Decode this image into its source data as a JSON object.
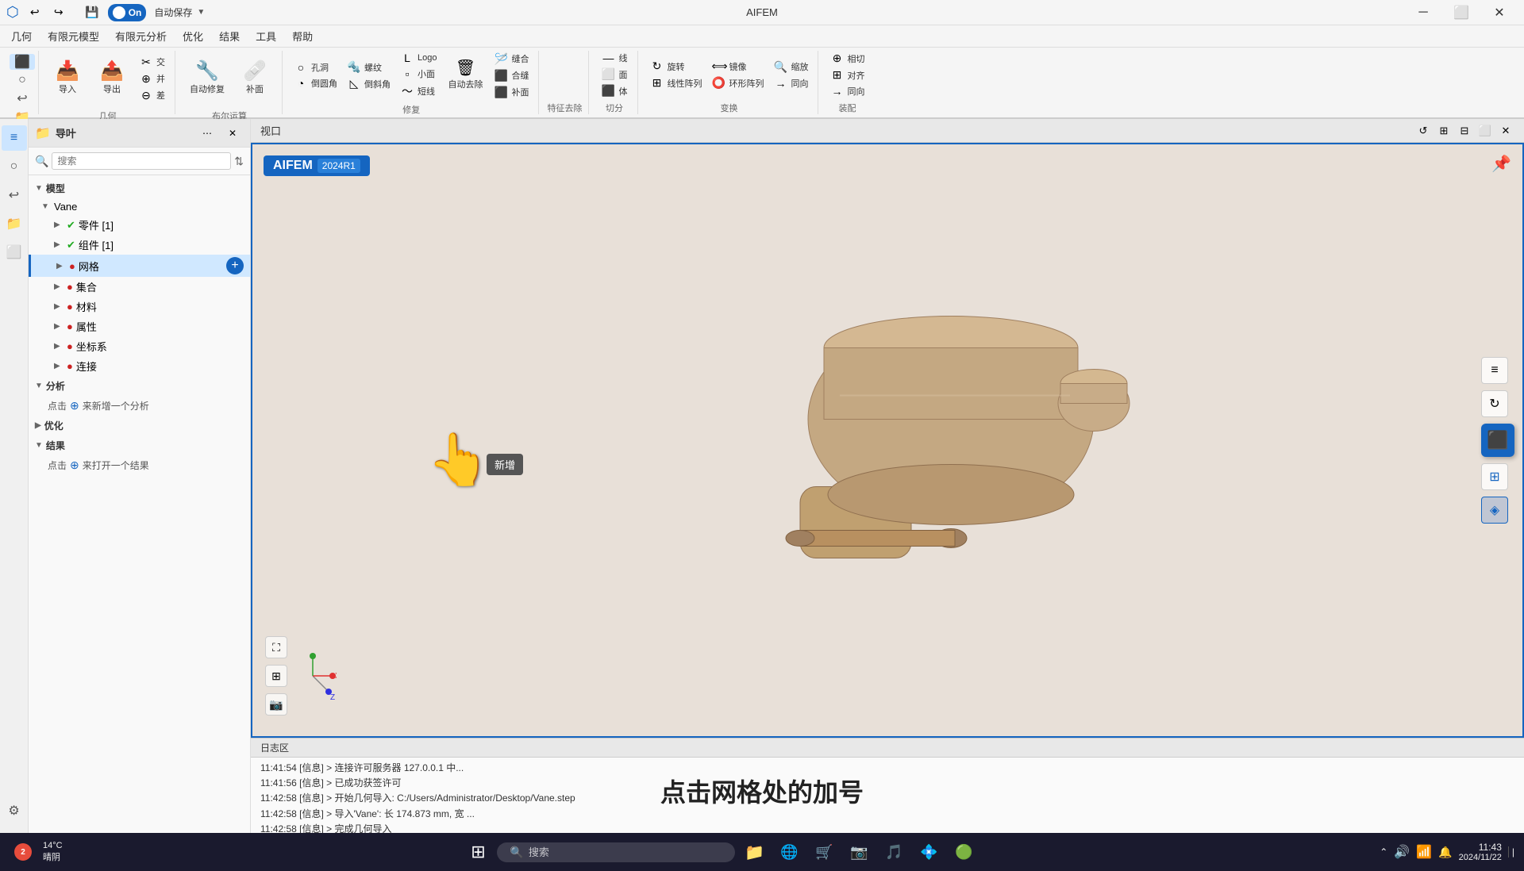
{
  "app": {
    "title": "AIFEM",
    "title_bar": {
      "toggle_text": "On",
      "autosave_label": "自动保存",
      "undo_label": "撤销",
      "redo_label": "重做",
      "save_label": "保存"
    }
  },
  "menu": {
    "items": [
      "几何",
      "有限元模型",
      "有限元分析",
      "优化",
      "结果",
      "工具",
      "帮助"
    ]
  },
  "ribbon": {
    "groups": [
      {
        "label": "几何",
        "items": [
          {
            "icon": "📥",
            "label": "导入"
          },
          {
            "icon": "📤",
            "label": "导出"
          },
          {
            "icon": "⊕",
            "label": "差"
          }
        ]
      },
      {
        "label": "布尔运算",
        "items": [
          {
            "icon": "✂",
            "label": "交"
          },
          {
            "icon": "⊕",
            "label": "并"
          },
          {
            "icon": "✂",
            "label": "差"
          }
        ]
      },
      {
        "label": "修复",
        "items": [
          {
            "icon": "🔧",
            "label": "自动修复"
          },
          {
            "icon": "🔧",
            "label": "补面"
          }
        ]
      },
      {
        "label": "特征去除",
        "rows": [
          [
            {
              "icon": "○",
              "label": "孔洞"
            },
            {
              "icon": "◯",
              "label": "倒圆角"
            },
            {
              "icon": "L",
              "label": "Logo"
            }
          ],
          [
            {
              "icon": "螺",
              "label": "螺纹"
            },
            {
              "icon": "◺",
              "label": "倒斜角"
            },
            {
              "icon": "—",
              "label": "小面"
            },
            {
              "icon": "〜",
              "label": "短线"
            }
          ]
        ],
        "big_items": [
          {
            "icon": "⬜",
            "label": "缝合"
          },
          {
            "icon": "⬜",
            "label": "合缝"
          },
          {
            "icon": "⬜",
            "label": "补面"
          },
          {
            "icon": "⬜",
            "label": "自动去除"
          }
        ]
      },
      {
        "label": "切分",
        "items": [
          {
            "icon": "—",
            "label": "线"
          },
          {
            "icon": "⬜",
            "label": "面"
          },
          {
            "icon": "⬛",
            "label": "体"
          }
        ]
      },
      {
        "label": "变换",
        "items": [
          {
            "icon": "↻",
            "label": "旋转"
          },
          {
            "icon": "⬜",
            "label": "阵列"
          },
          {
            "icon": "⬜",
            "label": "镜像"
          },
          {
            "icon": "⬜",
            "label": "环形阵列"
          },
          {
            "icon": "🔍",
            "label": "缩放"
          },
          {
            "icon": "→",
            "label": "同向"
          }
        ]
      },
      {
        "label": "装配",
        "items": [
          {
            "icon": "⊕",
            "label": "相切"
          },
          {
            "icon": "⊕",
            "label": "对齐"
          },
          {
            "icon": "⊕",
            "label": "同向"
          }
        ]
      }
    ]
  },
  "sidebar": {
    "title": "导叶",
    "search_placeholder": "搜索",
    "tree": {
      "model_label": "模型",
      "vane_label": "Vane",
      "parts_label": "零件 [1]",
      "groups_label": "组件 [1]",
      "mesh_label": "网格",
      "sets_label": "集合",
      "materials_label": "材料",
      "properties_label": "属性",
      "coords_label": "坐标系",
      "connections_label": "连接",
      "analysis_label": "分析",
      "analysis_click": "点击",
      "analysis_add": "来新增一个分析",
      "optimization_label": "优化",
      "results_label": "结果",
      "results_click": "点击",
      "results_open": "来打开一个结果"
    },
    "tooltip": "新增"
  },
  "viewport": {
    "title": "视口",
    "badge_text": "AIFEM",
    "badge_version": "2024R1"
  },
  "log": {
    "title": "日志区",
    "lines": [
      "11:41:54 [信息] > 连接许可服务器 127.0.0.1 中...",
      "11:41:56 [信息] > 已成功获签许可",
      "11:42:58 [信息] > 开始几何导入: C:/Users/Administrator/Desktop/Vane.step",
      "11:42:58 [信息] > 导入'Vane': 长 174.873 mm, 宽 ...",
      "11:42:58 [信息] > 完成几何导入"
    ],
    "hint": "点击网格处的加号"
  },
  "statusbar": {
    "weather": "14°C",
    "weather_desc": "晴阴",
    "weather_num": "2",
    "time": "11:43",
    "date": "2024/11/22",
    "search_placeholder": "搜索"
  },
  "colors": {
    "accent": "#1565c0",
    "status_green": "#22aa22",
    "status_red": "#cc2222",
    "bg_viewport": "#e8e0d8"
  }
}
